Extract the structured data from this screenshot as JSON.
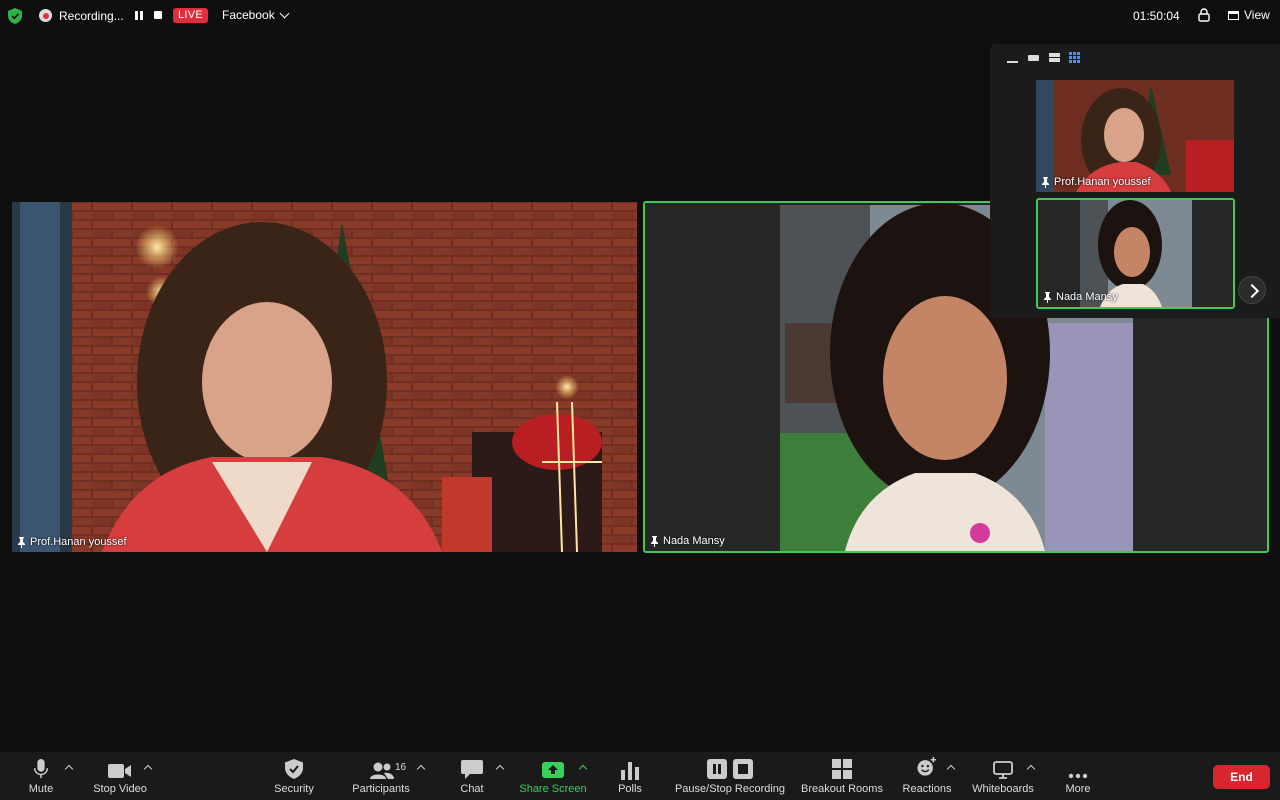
{
  "topbar": {
    "recording_label": "Recording...",
    "live_label": "LIVE",
    "stream_target": "Facebook",
    "timer": "01:50:04",
    "view_label": "View"
  },
  "main_tiles": [
    {
      "name": "Prof.Hanan youssef",
      "active": false
    },
    {
      "name": "Nada Mansy",
      "active": true
    }
  ],
  "thumbnails": [
    {
      "name": "Prof.Hanan youssef"
    },
    {
      "name": "Nada Mansy"
    }
  ],
  "toolbar": {
    "mute": "Mute",
    "stop_video": "Stop Video",
    "security": "Security",
    "participants": "Participants",
    "participant_count": "16",
    "chat": "Chat",
    "share_screen": "Share Screen",
    "polls": "Polls",
    "pause_stop_recording": "Pause/Stop Recording",
    "breakout_rooms": "Breakout Rooms",
    "reactions": "Reactions",
    "whiteboards": "Whiteboards",
    "more": "More",
    "end": "End"
  },
  "colors": {
    "live_red": "#e02e3c",
    "active_border": "#3dca5a",
    "share_green": "#35d15a",
    "end_red": "#d8262f"
  }
}
